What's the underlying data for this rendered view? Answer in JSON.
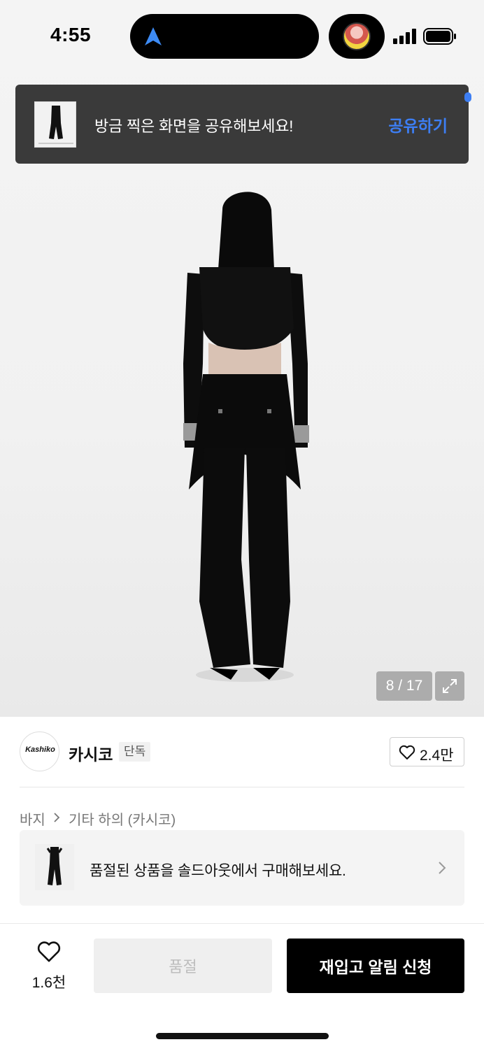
{
  "status_bar": {
    "time": "4:55"
  },
  "share_toast": {
    "message": "방금 찍은 화면을 공유해보세요!",
    "action_label": "공유하기"
  },
  "product_image": {
    "counter": "8 / 17"
  },
  "brand": {
    "logo_text": "Kashiko",
    "name": "카시코",
    "badge": "단독",
    "like_count": "2.4만"
  },
  "breadcrumb": {
    "items": [
      "바지",
      "기타 하의 (카시코)"
    ]
  },
  "soldout_banner": {
    "text": "품절된 상품을 솔드아웃에서 구매해보세요."
  },
  "bottom_bar": {
    "wish_count": "1.6천",
    "soldout_label": "품절",
    "restock_label": "재입고 알림 신청"
  },
  "colors": {
    "accent_blue": "#3d7ef3",
    "toast_bg": "#3a3a3a",
    "primary_button": "#000000"
  }
}
